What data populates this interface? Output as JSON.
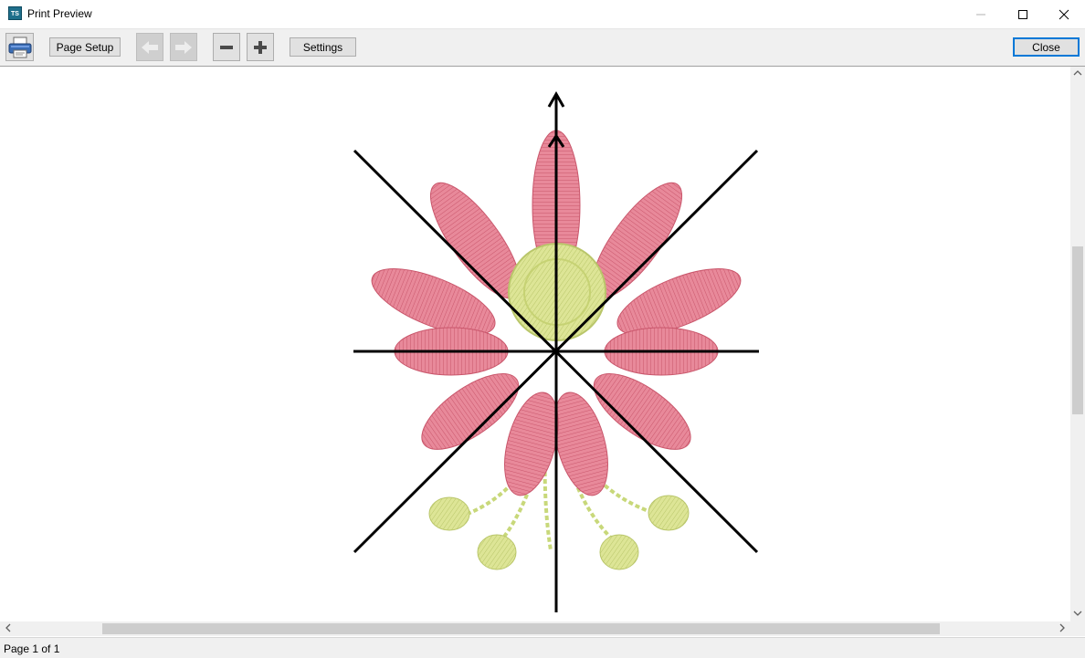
{
  "window": {
    "title": "Print Preview",
    "app_icon_text": "TS",
    "icons": [
      "minimize-icon",
      "maximize-icon",
      "close-window-icon"
    ]
  },
  "toolbar": {
    "print_icon": "printer-icon",
    "page_setup_label": "Page Setup",
    "prev_icon": "arrow-left-icon",
    "next_icon": "arrow-right-icon",
    "zoom_out_icon": "minus-icon",
    "zoom_in_icon": "plus-icon",
    "settings_label": "Settings",
    "close_label": "Close"
  },
  "preview": {
    "design": "flower-embroidery",
    "colors": {
      "petal": "#e87a8c",
      "petal_dark": "#c9566b",
      "center": "#d9e48f",
      "stem": "#c8d87a",
      "axes": "#000000"
    }
  },
  "status": {
    "page_text": "Page 1 of 1"
  }
}
